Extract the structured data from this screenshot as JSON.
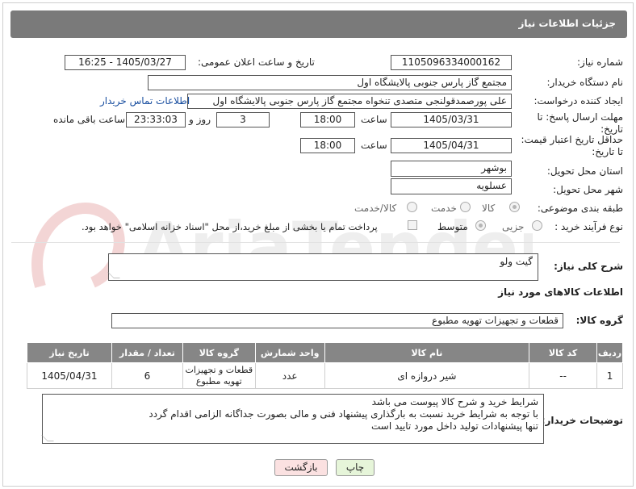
{
  "header": {
    "title": "جزئیات اطلاعات نیاز"
  },
  "form": {
    "need_number_label": "شماره نیاز:",
    "need_number": "1105096334000162",
    "announce_label": "تاریخ و ساعت اعلان عمومی:",
    "announce_value": "1405/03/27 - 16:25",
    "buyer_label": "نام دستگاه خریدار:",
    "buyer_value": "مجتمع گاز پارس جنوبی  پالایشگاه اول",
    "creator_label": "ایجاد کننده درخواست:",
    "creator_value": "علی پورصمدقولنجی متصدی تنخواه مجتمع گاز پارس جنوبی  پالایشگاه اول",
    "contact_link": "اطلاعات تماس خریدار",
    "deadline_label_1": "مهلت ارسال پاسخ: تا",
    "deadline_label_2": "تاریخ:",
    "deadline_date": "1405/03/31",
    "time_word": "ساعت",
    "deadline_time": "18:00",
    "days_value": "3",
    "days_word": "روز و",
    "remaining_time": "23:33:03",
    "remaining_word": "ساعت باقی مانده",
    "min_price_label_1": "حداقل تاریخ اعتبار قیمت:",
    "min_price_label_2": "تا تاریخ:",
    "min_price_date": "1405/04/31",
    "min_price_time": "18:00",
    "province_label": "استان محل تحویل:",
    "province_value": "بوشهر",
    "city_label": "شهر محل تحویل:",
    "city_value": "عسلویه",
    "category_label": "طبقه بندی موضوعی:",
    "category_options": [
      "کالا",
      "خدمت",
      "کالا/خدمت"
    ],
    "category_selected": "کالا",
    "process_label": "نوع فرآیند خرید :",
    "process_options": [
      "جزیی",
      "متوسط"
    ],
    "process_selected": "متوسط",
    "payment_note": "پرداخت تمام یا بخشی از مبلغ خرید،از محل \"اسناد خزانه اسلامی\" خواهد بود.",
    "summary_label": "شرح کلی نیاز:",
    "summary_value": "گیت ولو",
    "goods_info_title": "اطلاعات کالاهای مورد نیاز",
    "goods_group_label": "گروه کالا:",
    "goods_group_value": "قطعات و تجهیزات تهویه مطبوع"
  },
  "table": {
    "columns": [
      "ردیف",
      "کد کالا",
      "نام کالا",
      "واحد شمارش",
      "گروه کالا",
      "تعداد / مقدار",
      "تاریخ نیاز"
    ],
    "rows": [
      [
        "1",
        "--",
        "شیر دروازه ای",
        "عدد",
        "قطعات و تجهیزات تهویه مطبوع",
        "6",
        "1405/04/31"
      ]
    ]
  },
  "notes": {
    "label": "توضیحات خریدار:",
    "lines": [
      "شرایط خرید و شرح کالا  پیوست می باشد",
      "با توجه به شرایط خرید نسبت به بارگذاری پیشنهاد فنی و مالی بصورت جداگانه الزامی اقدام گردد",
      "تنها پیشنهادات تولید داخل مورد تایید است"
    ]
  },
  "buttons": {
    "print": "چاپ",
    "back": "بازگشت"
  },
  "watermark": {
    "text": "AriaTender.neT"
  },
  "colors": {
    "header_bg": "#7a7a7a",
    "table_header_bg": "#868686",
    "print_bg": "#e6f5d9",
    "back_bg": "#fbe1e1",
    "link": "#1a4fa0"
  }
}
